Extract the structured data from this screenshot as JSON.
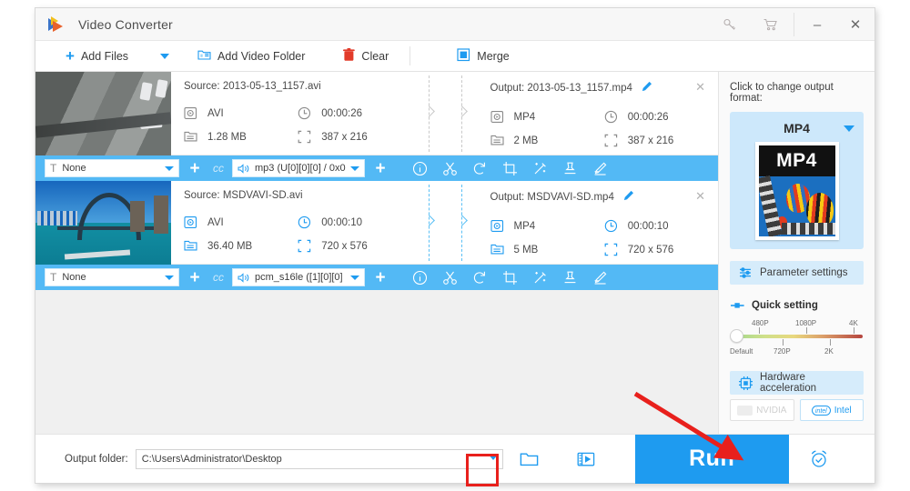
{
  "window": {
    "title": "Video Converter",
    "logo_icon": "play-triangle-logo",
    "title_icons": [
      {
        "name": "key-icon",
        "glyph": "⚷"
      },
      {
        "name": "cart-icon",
        "glyph": "🛒"
      }
    ],
    "minimize_label": "–",
    "close_label": "✕"
  },
  "toolbar": {
    "add_files_label": "Add Files",
    "add_files_icon": "plus-icon",
    "add_files_caret_icon": "chevron-down-icon",
    "add_video_folder_label": "Add Video Folder",
    "add_video_folder_icon": "folder-video-icon",
    "clear_label": "Clear",
    "clear_icon": "trash-icon",
    "merge_label": "Merge",
    "merge_icon": "merge-squares-icon"
  },
  "files": [
    {
      "thumbnail": "aerial-road-thumbnail",
      "source": {
        "label": "Source: 2013-05-13_1157.avi",
        "format": "AVI",
        "duration": "00:00:26",
        "size": "1.28 MB",
        "resolution": "387 x 216"
      },
      "output": {
        "label": "Output: 2013-05-13_1157.mp4",
        "format": "MP4",
        "duration": "00:00:26",
        "size": "2 MB",
        "resolution": "387 x 216",
        "edit_icon": "pencil-icon"
      },
      "remove_icon": "close-icon",
      "strip": {
        "subtitle_value": "None",
        "subtitle_icon": "text-T-icon",
        "add_subtitle_icon": "plus-icon",
        "cc_label": "cc",
        "audio_value": "mp3 (U[0][0][0] / 0x0",
        "audio_icon": "speaker-icon",
        "add_audio_icon": "plus-icon",
        "tools": [
          {
            "name": "info-icon",
            "glyph": "i"
          },
          {
            "name": "cut-icon",
            "glyph": "scissors"
          },
          {
            "name": "rotate-icon",
            "glyph": "rotate"
          },
          {
            "name": "crop-icon",
            "glyph": "crop"
          },
          {
            "name": "effect-icon",
            "glyph": "wand"
          },
          {
            "name": "watermark-icon",
            "glyph": "stamp"
          },
          {
            "name": "subtitle-edit-icon",
            "glyph": "edit"
          }
        ]
      }
    },
    {
      "thumbnail": "sydney-bridge-thumbnail",
      "source": {
        "label": "Source: MSDVAVI-SD.avi",
        "format": "AVI",
        "duration": "00:00:10",
        "size": "36.40 MB",
        "resolution": "720 x 576"
      },
      "output": {
        "label": "Output: MSDVAVI-SD.mp4",
        "format": "MP4",
        "duration": "00:00:10",
        "size": "5 MB",
        "resolution": "720 x 576",
        "edit_icon": "pencil-icon"
      },
      "remove_icon": "close-icon",
      "strip": {
        "subtitle_value": "None",
        "subtitle_icon": "text-T-icon",
        "add_subtitle_icon": "plus-icon",
        "cc_label": "cc",
        "audio_value": "pcm_s16le ([1][0][0]",
        "audio_icon": "speaker-icon",
        "add_audio_icon": "plus-icon",
        "tools": [
          {
            "name": "info-icon",
            "glyph": "i"
          },
          {
            "name": "cut-icon",
            "glyph": "scissors"
          },
          {
            "name": "rotate-icon",
            "glyph": "rotate"
          },
          {
            "name": "crop-icon",
            "glyph": "crop"
          },
          {
            "name": "effect-icon",
            "glyph": "wand"
          },
          {
            "name": "watermark-icon",
            "glyph": "stamp"
          },
          {
            "name": "subtitle-edit-icon",
            "glyph": "edit"
          }
        ]
      }
    }
  ],
  "right_panel": {
    "hint": "Click to change output format:",
    "format_name": "MP4",
    "format_caret_icon": "chevron-down-icon",
    "format_thumb_label": "MP4",
    "parameter_settings_label": "Parameter settings",
    "parameter_settings_icon": "sliders-icon",
    "quick_setting_label": "Quick setting",
    "quick_setting_icon": "slider-handle-icon",
    "quality_top_labels": [
      "480P",
      "1080P",
      "4K"
    ],
    "quality_bottom_labels": [
      "Default",
      "720P",
      "2K"
    ],
    "quality_value": "Default",
    "hardware_acceleration_label": "Hardware acceleration",
    "hardware_acceleration_icon": "chip-icon",
    "gpus": [
      {
        "label": "NVIDIA",
        "icon": "nvidia-icon",
        "enabled": false
      },
      {
        "label": "Intel",
        "icon": "intel-icon",
        "enabled": true
      }
    ]
  },
  "footer": {
    "output_folder_label": "Output folder:",
    "output_folder_path": "C:\\Users\\Administrator\\Desktop",
    "output_folder_caret_icon": "chevron-down-icon",
    "browse_folder_icon": "folder-icon",
    "open_media_icon": "film-folder-icon",
    "run_label": "Run",
    "schedule_icon": "alarm-clock-icon"
  },
  "annotation": {
    "arrow_color": "#e8201c",
    "highlight_color": "#e8201c"
  }
}
